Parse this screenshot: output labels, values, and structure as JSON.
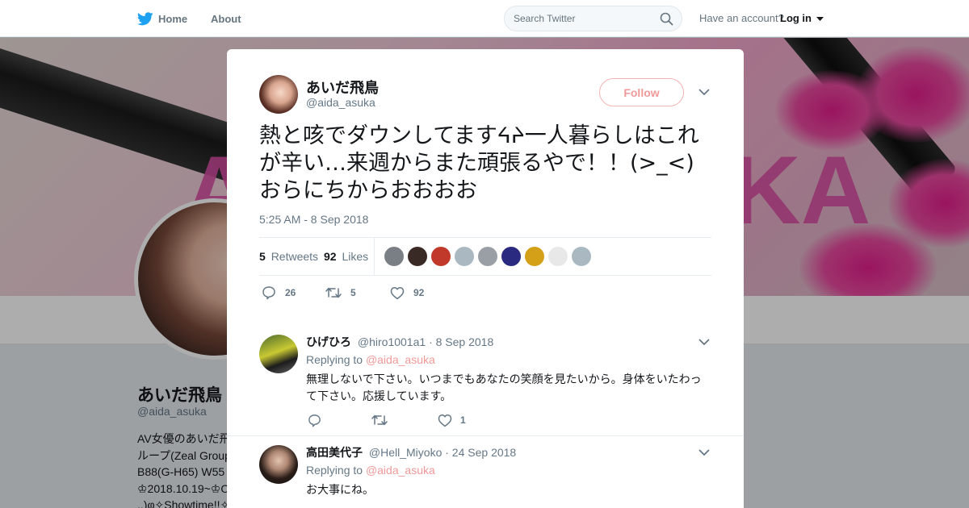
{
  "nav": {
    "home_label": "Home",
    "about_label": "About",
    "search_placeholder": "Search Twitter",
    "account_prompt": "Have an account?",
    "login_label": "Log in",
    "brand_color": "#1da1f2"
  },
  "background_profile": {
    "banner_letters": [
      "A",
      "KA"
    ],
    "name": "あいだ飛鳥",
    "handle": "@aida_asuka",
    "bio": "AV女優のあいだ飛\nループ(Zeal Group\nB88(G-H65) W55\n♔2018.10.19~♔O\n..)φ✧Showtime!!✧"
  },
  "tweet": {
    "author_name": "あいだ飛鳥",
    "author_handle": "@aida_asuka",
    "follow_label": "Follow",
    "text": "熱と咳でダウンしてますᔦᔨ一人暮らしはこれが辛い…来週からまた頑張るやで！！(>_<)おらにちからおおおお",
    "timestamp": "5:25 AM - 8 Sep 2018",
    "retweets_count": "5",
    "retweets_label": "Retweets",
    "likes_count": "92",
    "likes_label": "Likes",
    "liker_avatar_colors": [
      "#7a7f86",
      "#3a2a26",
      "#c0392b",
      "#aab8c2",
      "#9a9fa6",
      "#2a2a80",
      "#d4a017",
      "#e8e8e8",
      "#aab8c2"
    ],
    "actions": {
      "reply_count": "26",
      "retweet_count": "5",
      "like_count": "92"
    },
    "accent_color": "#f19999"
  },
  "replies": [
    {
      "name": "ひげひろ",
      "handle": "@hiro1001a1",
      "date": "· 8 Sep 2018",
      "replying_prefix": "Replying to",
      "replying_to": "@aida_asuka",
      "text": "無理しないで下さい。いつまでもあなたの笑顔を見たいから。身体をいたわって下さい。応援しています。",
      "like_count": "1"
    },
    {
      "name": "高田美代子",
      "handle": "@Hell_Miyoko",
      "date": "· 24 Sep 2018",
      "replying_prefix": "Replying to",
      "replying_to": "@aida_asuka",
      "text": "お大事にね。"
    }
  ]
}
